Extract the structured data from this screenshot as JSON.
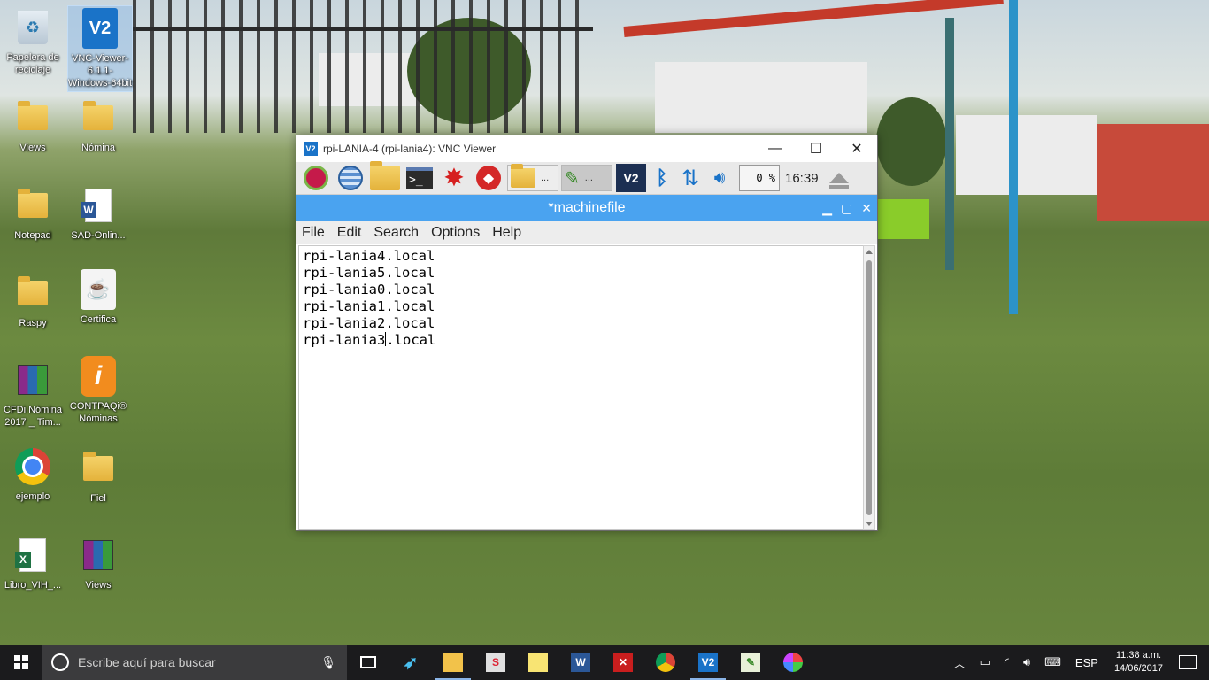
{
  "desktop": {
    "icons": [
      {
        "label": "Papelera de reciclaje",
        "icon": "recycle-bin-icon"
      },
      {
        "label": "VNC-Viewer-6.1.1-Windows-64bit",
        "icon": "vnc-viewer-icon"
      },
      {
        "label": "Views",
        "icon": "document-icon"
      },
      {
        "label": "Nómina",
        "icon": "folder-icon"
      },
      {
        "label": "Notepad",
        "icon": "folder-icon"
      },
      {
        "label": "SAD-Onlin...",
        "icon": "word-document-icon"
      },
      {
        "label": "Raspy",
        "icon": "folder-icon"
      },
      {
        "label": "Certifica",
        "icon": "java-icon"
      },
      {
        "label": "CFDi Nómina 2017 _ Tim...",
        "icon": "winrar-icon"
      },
      {
        "label": "CONTPAQi® Nóminas",
        "icon": "contpaqi-icon"
      },
      {
        "label": "ejemplo",
        "icon": "chrome-icon"
      },
      {
        "label": "Fiel",
        "icon": "folder-icon"
      },
      {
        "label": "Libro_VIH_...",
        "icon": "excel-icon"
      },
      {
        "label": "Views",
        "icon": "winrar-icon"
      }
    ]
  },
  "vnc_window": {
    "title": "rpi-LANIA-4 (rpi-lania4): VNC Viewer",
    "pi_panel": {
      "tasks": [
        "...",
        "..."
      ],
      "cpu": "0 %",
      "clock": "16:39"
    }
  },
  "leafpad": {
    "title": "*machinefile",
    "menu": [
      "File",
      "Edit",
      "Search",
      "Options",
      "Help"
    ],
    "lines": [
      "rpi-lania4.local",
      "rpi-lania5.local",
      "rpi-lania0.local",
      "rpi-lania1.local",
      "rpi-lania2.local",
      "rpi-lania3.local"
    ],
    "caret_line_prefix": "rpi-lania3",
    "caret_line_suffix": ".local"
  },
  "taskbar": {
    "search_placeholder": "Escribe aquí para buscar",
    "language": "ESP",
    "time": "11:38 a.m.",
    "date": "14/06/2017"
  },
  "colors": {
    "leafpad_title": "#4aa3f0",
    "taskbar": "#1b1b1d",
    "vnc_brand": "#1a73c8"
  }
}
